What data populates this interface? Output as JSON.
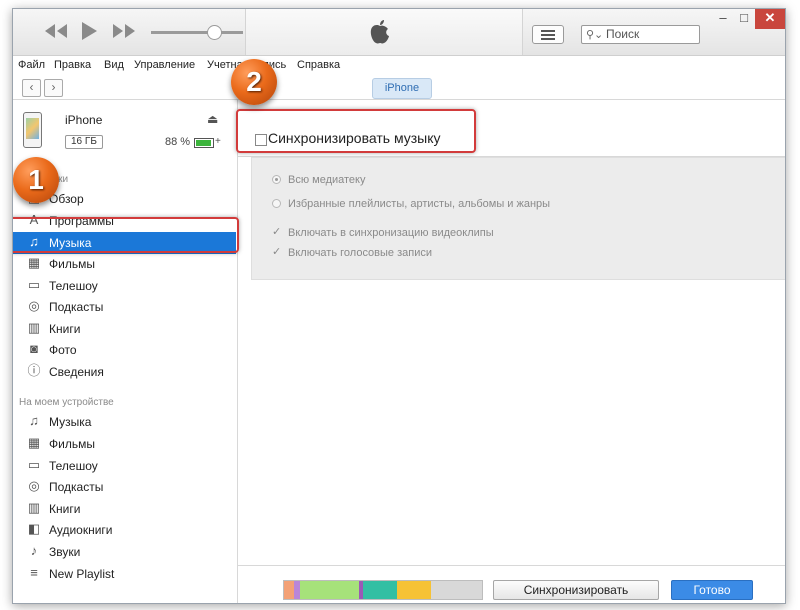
{
  "toolbar": {
    "search_placeholder": "Поиск",
    "window_buttons": {
      "minimize": "–",
      "maximize": "□",
      "close": "✕"
    }
  },
  "menu": [
    "Файл",
    "Правка",
    "Вид",
    "Управление",
    "Учетная запись",
    "Справка"
  ],
  "nav": {
    "device_tab": "iPhone"
  },
  "device": {
    "name": "iPhone",
    "capacity": "16 ГБ",
    "battery": "88 %"
  },
  "sidebar": {
    "settings_label": "Настройки",
    "settings_items": [
      {
        "label": "Обзор",
        "icon": "overview-icon"
      },
      {
        "label": "Программы",
        "icon": "apps-icon"
      },
      {
        "label": "Музыка",
        "icon": "music-note-icon",
        "active": true
      },
      {
        "label": "Фильмы",
        "icon": "film-icon"
      },
      {
        "label": "Телешоу",
        "icon": "tv-icon"
      },
      {
        "label": "Подкасты",
        "icon": "podcast-icon"
      },
      {
        "label": "Книги",
        "icon": "book-icon"
      },
      {
        "label": "Фото",
        "icon": "camera-icon"
      },
      {
        "label": "Сведения",
        "icon": "info-icon"
      }
    ],
    "device_label": "На моем устройстве",
    "device_items": [
      {
        "label": "Музыка",
        "icon": "music-note-icon"
      },
      {
        "label": "Фильмы",
        "icon": "film-icon"
      },
      {
        "label": "Телешоу",
        "icon": "tv-icon"
      },
      {
        "label": "Подкасты",
        "icon": "podcast-icon"
      },
      {
        "label": "Книги",
        "icon": "book-icon"
      },
      {
        "label": "Аудиокниги",
        "icon": "audiobook-icon"
      },
      {
        "label": "Звуки",
        "icon": "bell-icon"
      },
      {
        "label": "New Playlist",
        "icon": "playlist-icon"
      }
    ]
  },
  "main": {
    "sync_label": "Синхронизировать музыку",
    "options": {
      "all_library": "Всю медиатеку",
      "selected": "Избранные плейлисты, артисты, альбомы и жанры",
      "include_video": "Включать в синхронизацию видеоклипы",
      "include_voice": "Включать голосовые записи"
    },
    "sync_button": "Синхронизировать",
    "done_button": "Готово"
  },
  "storage_segments": [
    {
      "color": "#f3a176",
      "fraction": 0.05
    },
    {
      "color": "#b986d9",
      "fraction": 0.03
    },
    {
      "color": "#a6e27a",
      "fraction": 0.3
    },
    {
      "color": "#9b59b6",
      "fraction": 0.02
    },
    {
      "color": "#33bfa3",
      "fraction": 0.17
    },
    {
      "color": "#f6c235",
      "fraction": 0.17
    },
    {
      "color": "#d8d8d8",
      "fraction": 0.26
    }
  ],
  "annotations": {
    "step1": "1",
    "step2": "2"
  },
  "colors": {
    "accent": "#1b78d8",
    "badge": "#ea6a1a",
    "highlight": "#d23b3b"
  }
}
